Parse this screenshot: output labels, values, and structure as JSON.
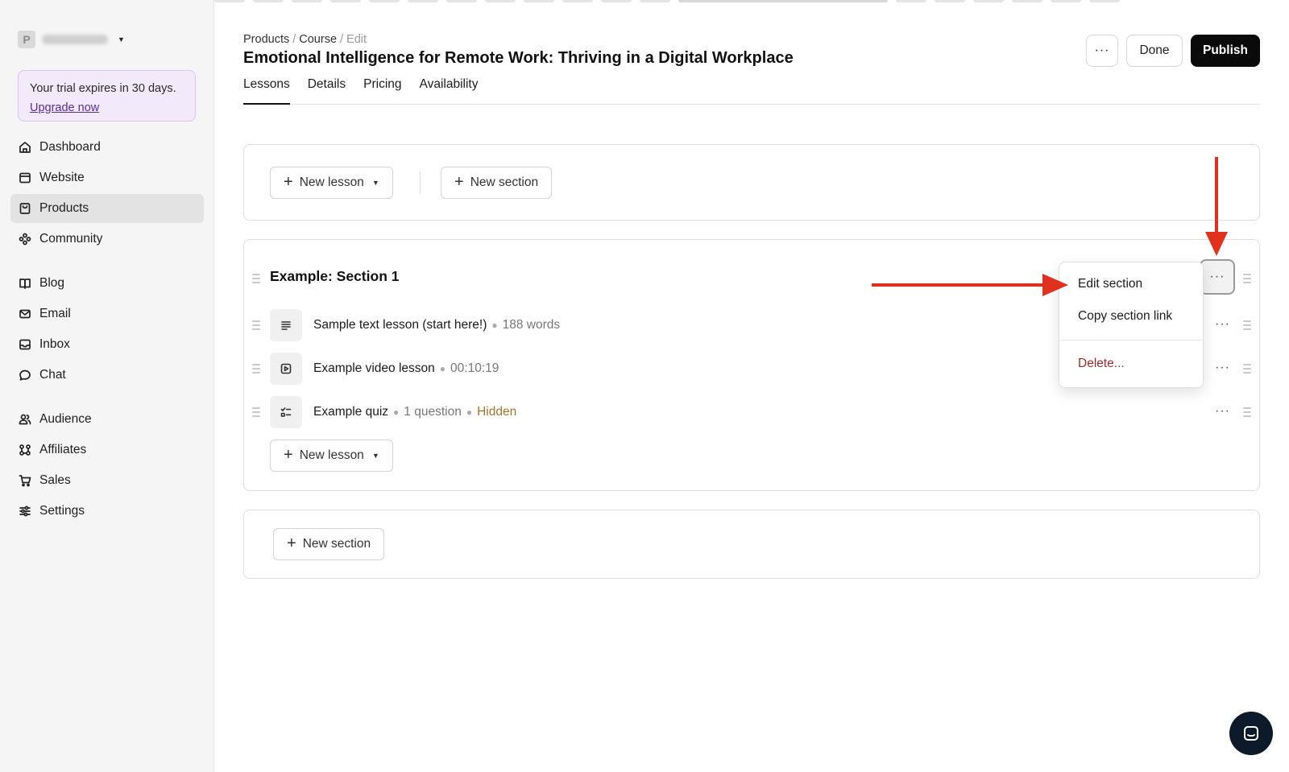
{
  "workspace": {
    "initial": "P"
  },
  "trial": {
    "text": "Your trial expires in 30 days.",
    "link": "Upgrade now"
  },
  "sidebar": {
    "groups": [
      [
        {
          "label": "Dashboard",
          "icon": "home-icon"
        },
        {
          "label": "Website",
          "icon": "browser-icon"
        },
        {
          "label": "Products",
          "icon": "bag-icon",
          "active": true
        },
        {
          "label": "Community",
          "icon": "community-icon"
        }
      ],
      [
        {
          "label": "Blog",
          "icon": "book-icon"
        },
        {
          "label": "Email",
          "icon": "mail-icon"
        },
        {
          "label": "Inbox",
          "icon": "inbox-icon"
        },
        {
          "label": "Chat",
          "icon": "chat-icon"
        }
      ],
      [
        {
          "label": "Audience",
          "icon": "users-icon"
        },
        {
          "label": "Affiliates",
          "icon": "affiliates-icon"
        },
        {
          "label": "Sales",
          "icon": "cart-icon"
        },
        {
          "label": "Settings",
          "icon": "sliders-icon"
        }
      ]
    ]
  },
  "breadcrumb": {
    "items": [
      "Products",
      "Course",
      "Edit"
    ]
  },
  "page": {
    "title": "Emotional Intelligence for Remote Work: Thriving in a Digital Workplace"
  },
  "tabs": [
    "Lessons",
    "Details",
    "Pricing",
    "Availability"
  ],
  "header_buttons": {
    "more": "···",
    "done": "Done",
    "publish": "Publish"
  },
  "toolbar": {
    "new_lesson": "New lesson",
    "new_section": "New section"
  },
  "section": {
    "title": "Example: Section 1",
    "lessons": [
      {
        "name": "Sample text lesson (start here!)",
        "meta": "188 words",
        "icon": "text-lines-icon"
      },
      {
        "name": "Example video lesson",
        "meta": "00:10:19",
        "icon": "video-icon"
      },
      {
        "name": "Example quiz",
        "meta": "1 question",
        "status": "Hidden",
        "icon": "quiz-icon"
      }
    ],
    "new_lesson": "New lesson"
  },
  "bottom": {
    "new_section": "New section"
  },
  "menu": {
    "items": [
      "Edit section",
      "Copy section link"
    ],
    "danger": "Delete..."
  },
  "colors": {
    "accent": "#0a0a0a",
    "trial_bg": "#f2e9fb",
    "arrow": "#e0301e",
    "hidden": "#a0742e",
    "danger": "#9b2c2c"
  }
}
